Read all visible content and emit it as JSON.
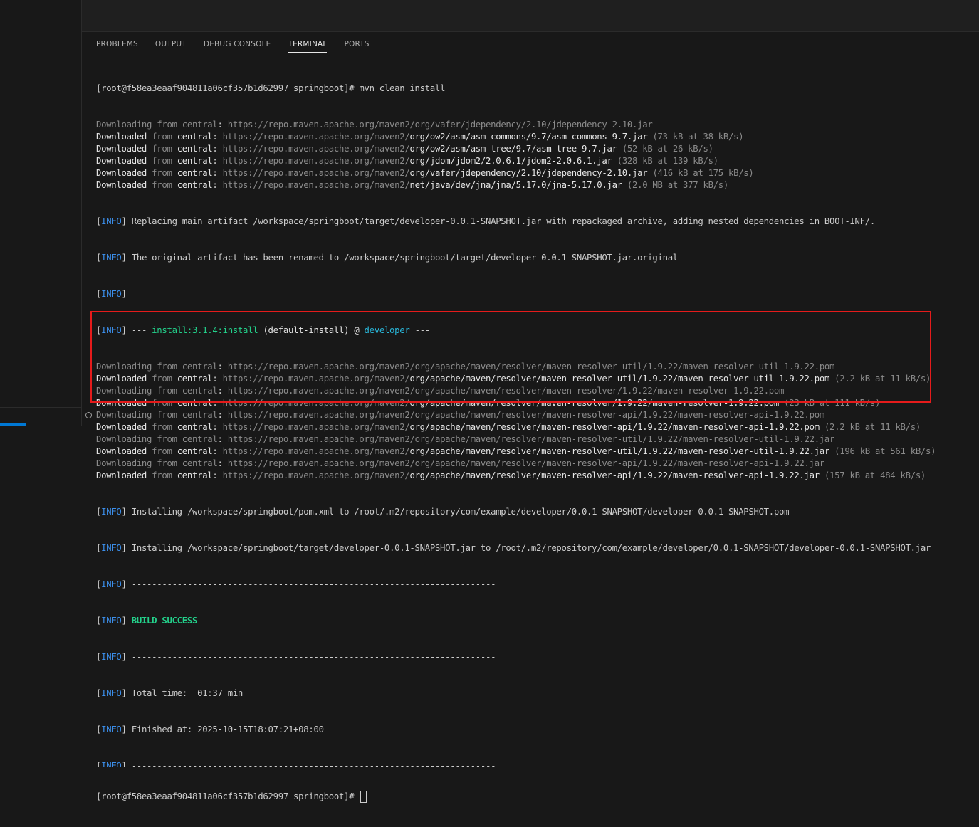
{
  "tabs": {
    "problems": "PROBLEMS",
    "output": "OUTPUT",
    "debug_console": "DEBUG CONSOLE",
    "terminal": "TERMINAL",
    "ports": "PORTS"
  },
  "terminal": {
    "prompt_cmd": "[root@f58ea3eaaf904811a06cf357b1d62997 springboot]# mvn clean install",
    "lines": [
      {
        "t": "dl",
        "v": "Downloading",
        "r": "org/vafer/jdependency/2.10/jdependency-2.10.jar",
        "s": ""
      },
      {
        "t": "dd",
        "v": "Downloaded",
        "r": "org/ow2/asm/asm-commons/9.7/asm-commons-9.7.jar",
        "s": "(73 kB at 38 kB/s)"
      },
      {
        "t": "dd",
        "v": "Downloaded",
        "r": "org/ow2/asm/asm-tree/9.7/asm-tree-9.7.jar",
        "s": "(52 kB at 26 kB/s)"
      },
      {
        "t": "dd",
        "v": "Downloaded",
        "r": "org/jdom/jdom2/2.0.6.1/jdom2-2.0.6.1.jar",
        "s": "(328 kB at 139 kB/s)"
      },
      {
        "t": "dd",
        "v": "Downloaded",
        "r": "org/vafer/jdependency/2.10/jdependency-2.10.jar",
        "s": "(416 kB at 175 kB/s)"
      },
      {
        "t": "dd",
        "v": "Downloaded",
        "r": "net/java/dev/jna/jna/5.17.0/jna-5.17.0.jar",
        "s": "(2.0 MB at 377 kB/s)"
      }
    ],
    "info_replacing": "Replacing main artifact /workspace/springboot/target/developer-0.0.1-SNAPSHOT.jar with repackaged archive, adding nested dependencies in BOOT-INF/.",
    "info_renamed": "The original artifact has been renamed to /workspace/springboot/target/developer-0.0.1-SNAPSHOT.jar.original",
    "info_tag": "INFO",
    "install_prefix": "---",
    "install_plugin": "install:3.1.4:install",
    "install_exec": "(default-install) @",
    "install_project": "developer",
    "install_suffix": "---",
    "lines2": [
      {
        "t": "dl",
        "v": "Downloading",
        "r": "org/apache/maven/resolver/maven-resolver-util/1.9.22/maven-resolver-util-1.9.22.pom",
        "s": ""
      },
      {
        "t": "dd",
        "v": "Downloaded",
        "r": "org/apache/maven/resolver/maven-resolver-util/1.9.22/maven-resolver-util-1.9.22.pom",
        "s": "(2.2 kB at 11 kB/s)"
      },
      {
        "t": "dl",
        "v": "Downloading",
        "r": "org/apache/maven/resolver/maven-resolver/1.9.22/maven-resolver-1.9.22.pom",
        "s": ""
      },
      {
        "t": "dd",
        "v": "Downloaded",
        "r": "org/apache/maven/resolver/maven-resolver/1.9.22/maven-resolver-1.9.22.pom",
        "s": "(23 kB at 111 kB/s)"
      },
      {
        "t": "dl",
        "v": "Downloading",
        "r": "org/apache/maven/resolver/maven-resolver-api/1.9.22/maven-resolver-api-1.9.22.pom",
        "s": ""
      },
      {
        "t": "dd",
        "v": "Downloaded",
        "r": "org/apache/maven/resolver/maven-resolver-api/1.9.22/maven-resolver-api-1.9.22.pom",
        "s": "(2.2 kB at 11 kB/s)"
      },
      {
        "t": "dl",
        "v": "Downloading",
        "r": "org/apache/maven/resolver/maven-resolver-util/1.9.22/maven-resolver-util-1.9.22.jar",
        "s": ""
      },
      {
        "t": "dd",
        "v": "Downloaded",
        "r": "org/apache/maven/resolver/maven-resolver-util/1.9.22/maven-resolver-util-1.9.22.jar",
        "s": "(196 kB at 561 kB/s)"
      },
      {
        "t": "dl",
        "v": "Downloading",
        "r": "org/apache/maven/resolver/maven-resolver-api/1.9.22/maven-resolver-api-1.9.22.jar",
        "s": ""
      },
      {
        "t": "dd",
        "v": "Downloaded",
        "r": "org/apache/maven/resolver/maven-resolver-api/1.9.22/maven-resolver-api-1.9.22.jar",
        "s": "(157 kB at 484 kB/s)"
      }
    ],
    "from": "from",
    "central": "central",
    "repo_base": "https://repo.maven.apache.org/maven2/",
    "installing_pom": "Installing /workspace/springboot/pom.xml to /root/.m2/repository/com/example/developer/0.0.1-SNAPSHOT/developer-0.0.1-SNAPSHOT.pom",
    "installing_jar": "Installing /workspace/springboot/target/developer-0.0.1-SNAPSHOT.jar to /root/.m2/repository/com/example/developer/0.0.1-SNAPSHOT/developer-0.0.1-SNAPSHOT.jar",
    "separator": "------------------------------------------------------------------------",
    "build_success": "BUILD SUCCESS",
    "total_time": "Total time:  01:37 min",
    "finished_at": "Finished at: 2025-10-15T18:07:21+08:00",
    "final_prompt": "[root@f58ea3eaaf904811a06cf357b1d62997 springboot]# "
  },
  "colors": {
    "info": "#3b8eea",
    "success": "#23d18b",
    "highlight_box": "#e51b1b",
    "background": "#181818"
  }
}
